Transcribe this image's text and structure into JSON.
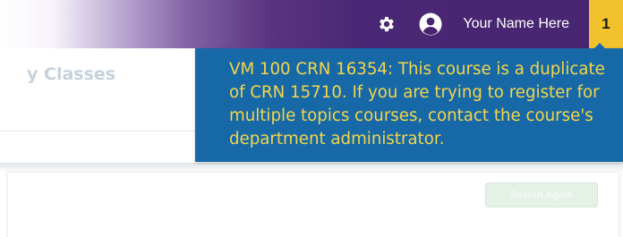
{
  "header": {
    "settings_icon": "gear-icon",
    "profile_icon": "user-circle-icon",
    "user_name": "Your Name Here",
    "notification_count": "1",
    "colors": {
      "bar": "#482570",
      "badge": "#f2c22c"
    }
  },
  "page": {
    "section_title": "y Classes",
    "search_again_label": "Search Again"
  },
  "notification": {
    "message": "VM 100 CRN 16354: This course is a duplicate of CRN 15710. If you are trying to register for multiple topics courses, contact the course's department administrator.",
    "colors": {
      "background": "#1669a6",
      "text": "#f4d54b"
    }
  }
}
